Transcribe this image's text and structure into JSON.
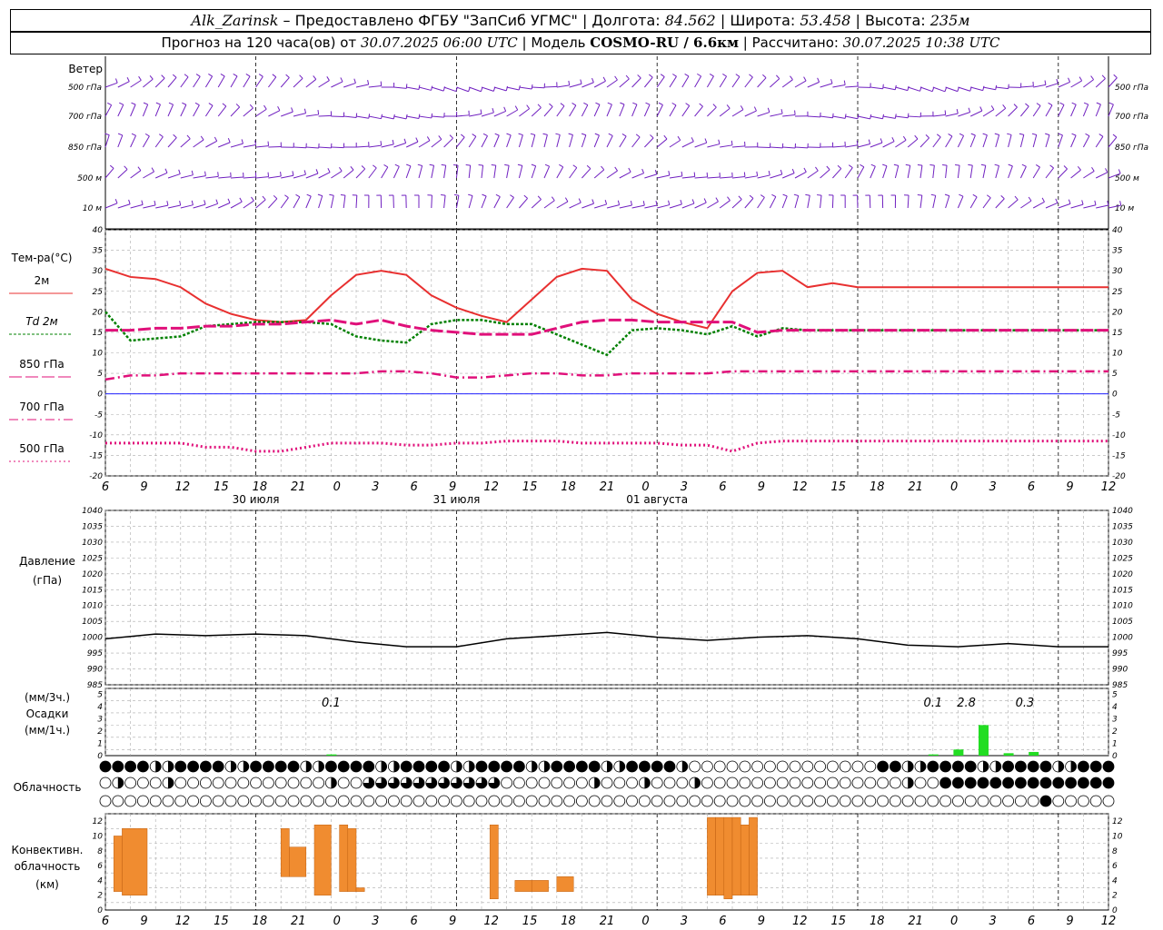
{
  "header": {
    "station": "Alk_Zarinsk",
    "provided_by": "Предоставлено ФГБУ \"ЗапСиб УГМС\"",
    "lon_label": "Долгота:",
    "lon": "84.562",
    "lat_label": "Широта:",
    "lat": "53.458",
    "alt_label": "Высота:",
    "alt": "235м",
    "forecast_prefix": "Прогноз на 120 часа(ов) от",
    "forecast_start": "30.07.2025 06:00 UTC",
    "model_label": "Модель",
    "model": "COSMO-RU / 6.6км",
    "calc_label": "Рассчитано:",
    "calc_time": "30.07.2025 10:38 UTC"
  },
  "colors": {
    "wind": "#7020c0",
    "t2m": "#e83030",
    "td2m": "#008000",
    "t850": "#e0107a",
    "t700": "#e0107a",
    "t500": "#e0107a",
    "pressure": "#000000",
    "precip": "#22dd22",
    "convective": "#f08c30",
    "zero_line": "#0000ff"
  },
  "x_axis": {
    "hour_labels": [
      "6",
      "9",
      "12",
      "15",
      "18",
      "21",
      "0",
      "3",
      "6",
      "9",
      "12",
      "15",
      "18",
      "21",
      "0",
      "3",
      "6",
      "9",
      "12",
      "15",
      "18",
      "21",
      "0",
      "3",
      "6",
      "9",
      "12"
    ],
    "date_labels": [
      "30 июля",
      "31 июля",
      "01 августа"
    ]
  },
  "wind_panel": {
    "title": "Ветер",
    "levels": [
      "500 гПа",
      "700 гПа",
      "850 гПа",
      "500 м",
      "10 м"
    ]
  },
  "temp_panel": {
    "title": "Тем-ра(°С)",
    "legend": [
      "2м",
      "Td 2м",
      "850 гПа",
      "700 гПа",
      "500 гПа"
    ],
    "ticks": [
      "40",
      "35",
      "30",
      "25",
      "20",
      "15",
      "10",
      "5",
      "0",
      "-5",
      "-10",
      "-15",
      "-20"
    ]
  },
  "pressure_panel": {
    "title_1": "Давление",
    "title_2": "(гПа)",
    "ticks": [
      "1040",
      "1035",
      "1030",
      "1025",
      "1020",
      "1015",
      "1010",
      "1005",
      "1000",
      "995",
      "990",
      "985"
    ]
  },
  "precip_panel": {
    "label_1": "(мм/3ч.)",
    "label_2": "Осадки",
    "label_3": "(мм/1ч.)",
    "ticks": [
      "5",
      "4",
      "3",
      "2",
      "1",
      "0"
    ],
    "annotations": [
      "0.1",
      "0.1",
      "2.8",
      "0.3"
    ]
  },
  "cloud_panel": {
    "title": "Облачность"
  },
  "conv_panel": {
    "title_1": "Конвективн.",
    "title_2": "облачность",
    "title_3": "(км)",
    "ticks": [
      "12",
      "10",
      "8",
      "6",
      "4",
      "2",
      "0"
    ]
  },
  "chart_data": [
    {
      "type": "line",
      "title": "Тем-ра(°С)",
      "x_hours_from_start": [
        0,
        3,
        6,
        9,
        12,
        15,
        18,
        21,
        24,
        27,
        30,
        33,
        36,
        39,
        42,
        45,
        48,
        51,
        54,
        57,
        60,
        63,
        66,
        69,
        72,
        75,
        78,
        81,
        84,
        87,
        90,
        93,
        96,
        99,
        102,
        105,
        108,
        111,
        114,
        117,
        120
      ],
      "ylim": [
        -20,
        40
      ],
      "series": [
        {
          "name": "2м",
          "values": [
            30.5,
            28.5,
            28,
            26,
            22,
            19.5,
            18,
            17.5,
            18,
            24,
            29,
            30,
            29,
            24,
            21,
            19,
            17.5,
            23,
            28.5,
            30.5,
            30,
            23,
            19.5,
            17.5,
            16,
            25,
            29.5,
            30,
            26,
            27,
            26,
            26,
            26,
            26,
            26,
            26,
            26,
            26,
            26,
            26,
            26
          ]
        },
        {
          "name": "Td 2м",
          "values": [
            20,
            13,
            13.5,
            14,
            16.5,
            17,
            17.5,
            17.5,
            17.5,
            17,
            14,
            13,
            12.5,
            17,
            18,
            18,
            17,
            17,
            14.5,
            12,
            9.5,
            15.5,
            16,
            15.5,
            14.5,
            16.5,
            14,
            16,
            15.5,
            15.5,
            15.5,
            15.5,
            15.5,
            15.5,
            15.5,
            15.5,
            15.5,
            15.5,
            15.5,
            15.5,
            15.5
          ]
        },
        {
          "name": "850 гПа",
          "values": [
            15.5,
            15.5,
            16,
            16,
            16.5,
            16.5,
            17,
            17,
            17.5,
            18,
            17,
            18,
            16.5,
            15.5,
            15,
            14.5,
            14.5,
            14.5,
            16,
            17.5,
            18,
            18,
            17.5,
            17.5,
            17.5,
            17.5,
            15,
            15.5,
            15.5,
            15.5,
            15.5,
            15.5,
            15.5,
            15.5,
            15.5,
            15.5,
            15.5,
            15.5,
            15.5,
            15.5,
            15.5
          ]
        },
        {
          "name": "700 гПа",
          "values": [
            3.5,
            4.5,
            4.5,
            5,
            5,
            5,
            5,
            5,
            5,
            5,
            5,
            5.5,
            5.5,
            5,
            4,
            4,
            4.5,
            5,
            5,
            4.5,
            4.5,
            5,
            5,
            5,
            5,
            5.5,
            5.5,
            5.5,
            5.5,
            5.5,
            5.5,
            5.5,
            5.5,
            5.5,
            5.5,
            5.5,
            5.5,
            5.5,
            5.5,
            5.5,
            5.5
          ]
        },
        {
          "name": "500 гПа",
          "values": [
            -12,
            -12,
            -12,
            -12,
            -13,
            -13,
            -14,
            -14,
            -13,
            -12,
            -12,
            -12,
            -12.5,
            -12.5,
            -12,
            -12,
            -11.5,
            -11.5,
            -11.5,
            -12,
            -12,
            -12,
            -12,
            -12.5,
            -12.5,
            -14,
            -12,
            -11.5,
            -11.5,
            -11.5,
            -11.5,
            -11.5,
            -11.5,
            -11.5,
            -11.5,
            -11.5,
            -11.5,
            -11.5,
            -11.5,
            -11.5,
            -11.5
          ]
        }
      ]
    },
    {
      "type": "line",
      "title": "Давление",
      "x_hours_from_start": [
        0,
        6,
        12,
        18,
        24,
        30,
        36,
        42,
        48,
        54,
        60,
        66,
        72,
        78,
        84,
        90,
        96,
        102,
        108,
        114,
        120
      ],
      "ylim": [
        985,
        1040
      ],
      "series": [
        {
          "name": "Давление",
          "values": [
            999.5,
            1001,
            1000.5,
            1001,
            1000.5,
            998.5,
            997,
            997,
            999.5,
            1000.5,
            1001.5,
            1000,
            999,
            1000,
            1000.5,
            999.5,
            997.5,
            997,
            998,
            997,
            997
          ]
        }
      ]
    },
    {
      "type": "bar",
      "title": "Осадки",
      "x_hours_from_start": [
        27,
        99,
        102,
        105,
        108,
        111
      ],
      "ylim": [
        0,
        5
      ],
      "values": [
        0.1,
        0.1,
        0.5,
        2.5,
        0.2,
        0.3
      ]
    },
    {
      "type": "bar",
      "title": "Конвективн. облачность",
      "ylim": [
        0,
        13
      ],
      "segments_hours_km": [
        [
          1,
          2,
          2.5,
          10
        ],
        [
          2,
          5,
          2,
          11
        ],
        [
          21,
          22,
          4.5,
          11
        ],
        [
          22,
          24,
          4.5,
          8.5
        ],
        [
          25,
          27,
          2,
          11.5
        ],
        [
          28,
          29,
          2.5,
          11.5
        ],
        [
          29,
          30,
          2.5,
          11
        ],
        [
          30,
          31,
          2.5,
          3
        ],
        [
          46,
          47,
          1.5,
          11.5
        ],
        [
          49,
          51,
          2.5,
          4
        ],
        [
          51,
          53,
          2.5,
          4
        ],
        [
          54,
          56,
          2.5,
          4.5
        ],
        [
          72,
          73,
          2,
          12.5
        ],
        [
          73,
          74,
          2,
          12.5
        ],
        [
          74,
          75,
          1.5,
          12.5
        ],
        [
          75,
          76,
          2,
          12.5
        ],
        [
          76,
          77,
          2,
          11.5
        ],
        [
          77,
          78,
          2,
          12.5
        ]
      ]
    }
  ]
}
